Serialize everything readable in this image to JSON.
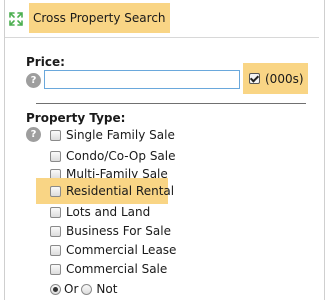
{
  "header": {
    "title": "Cross Property Search",
    "icon": "expand-icon"
  },
  "price": {
    "label": "Price:",
    "help_icon": "?",
    "input_value": "",
    "units_checked": true,
    "units_label": "(000s)"
  },
  "property_type": {
    "label": "Property Type:",
    "help_icon": "?",
    "options": [
      {
        "label": "Single Family Sale",
        "checked": false
      },
      {
        "label": "Condo/Co-Op Sale",
        "checked": false
      },
      {
        "label": "Multi-Family Sale",
        "checked": false
      },
      {
        "label": "Residential Rental",
        "checked": false,
        "highlighted": true
      },
      {
        "label": "Lots and Land",
        "checked": false
      },
      {
        "label": "Business For Sale",
        "checked": false
      },
      {
        "label": "Commercial Lease",
        "checked": false
      },
      {
        "label": "Commercial Sale",
        "checked": false
      }
    ],
    "mode": {
      "or_label": "Or",
      "not_label": "Not",
      "selected": "Or"
    }
  },
  "colors": {
    "highlight": "#f9d585",
    "input_border": "#6aa8dc",
    "help_icon": "#9e9e9e"
  }
}
